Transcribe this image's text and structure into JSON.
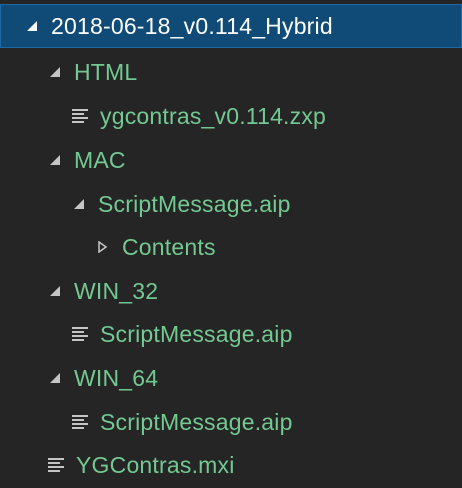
{
  "colors": {
    "background": "#252526",
    "selected_background": "#0f4b76",
    "label_green": "#73c991",
    "root_label": "#ffffff",
    "icon": "#c5c5c5"
  },
  "tree": {
    "root": {
      "label": "2018-06-18_v0.114_Hybrid",
      "icon": "chevron-down-icon",
      "expanded": true,
      "selected": true
    },
    "html_folder": {
      "label": "HTML",
      "icon": "chevron-down-icon",
      "expanded": true
    },
    "html_file": {
      "label": "ygcontras_v0.114.zxp",
      "icon": "file-lines-icon"
    },
    "mac_folder": {
      "label": "MAC",
      "icon": "chevron-down-icon",
      "expanded": true
    },
    "mac_aip_folder": {
      "label": "ScriptMessage.aip",
      "icon": "chevron-down-icon",
      "expanded": true
    },
    "mac_contents_folder": {
      "label": "Contents",
      "icon": "chevron-right-icon",
      "expanded": false
    },
    "win32_folder": {
      "label": "WIN_32",
      "icon": "chevron-down-icon",
      "expanded": true
    },
    "win32_file": {
      "label": "ScriptMessage.aip",
      "icon": "file-lines-icon"
    },
    "win64_folder": {
      "label": "WIN_64",
      "icon": "chevron-down-icon",
      "expanded": true
    },
    "win64_file": {
      "label": "ScriptMessage.aip",
      "icon": "file-lines-icon"
    },
    "mxi_file": {
      "label": "YGContras.mxi",
      "icon": "file-lines-icon"
    }
  }
}
